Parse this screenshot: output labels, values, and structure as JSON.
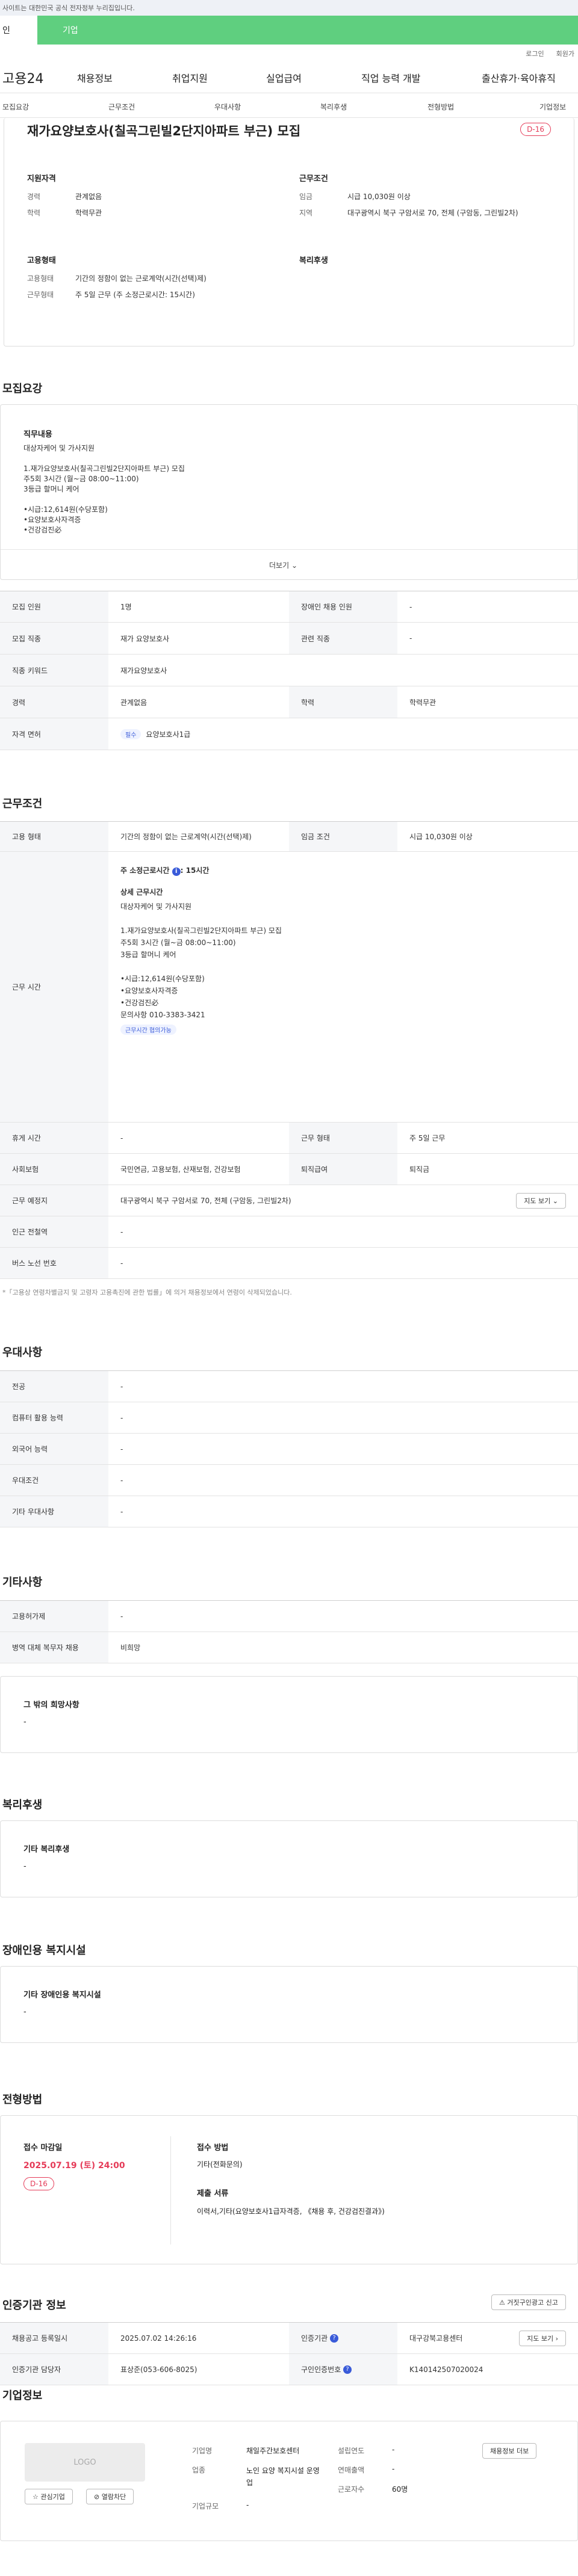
{
  "gov_banner": "사이트는 대한민국 공식 전자정부 누리집입니다.",
  "tabs": {
    "a": "인",
    "b": "기업"
  },
  "util": {
    "login": "로그인",
    "signup": "회원가"
  },
  "logo": "고용24",
  "gnb": [
    "채용정보",
    "취업지원",
    "실업급여",
    "직업 능력 개발",
    "출산휴가·육아휴직"
  ],
  "sub_tabs": [
    "모집요강",
    "근무조건",
    "우대사항",
    "복리후생",
    "전형방법",
    "기업정보"
  ],
  "job_title": "재가요양보호사(칠곡그린빌2단지아파트 부근) 모집",
  "dday": "D-16",
  "summary": {
    "qual_h": "지원자격",
    "career_k": "경력",
    "career_v": "관계없음",
    "edu_k": "학력",
    "edu_v": "학력무관",
    "work_h": "근무조건",
    "wage_k": "임금",
    "wage_v": "시급 10,030원 이상",
    "area_k": "지역",
    "area_v": "대구광역시 북구 구암서로 70, 전체 (구암동, 그린빌2차)",
    "emp_h": "고용형태",
    "emptype_k": "고용형태",
    "emptype_v": "기간의 정함이 없는 근로계약(시간(선택)제)",
    "worktype_k": "근무형태",
    "worktype_v": "주 5일 근무 (주 소정근로시간: 15시간)",
    "welfare_h": "복리후생"
  },
  "s_recruit": {
    "title": "모집요강",
    "duty_h": "직무내용",
    "duty_lines": [
      "대상자케어 및 가사지원",
      "",
      "1.재가요양보호사(칠곡그린빌2단지아파트 부근) 모집",
      "주5회 3시간 (월~금 08:00~11:00)",
      "3등급 할머니 케어",
      "",
      "•시급:12,614원(수당포함)",
      "•요양보호사자격증",
      "•건강검진必"
    ],
    "more": "더보기",
    "rows": [
      {
        "k1": "모집 인원",
        "v1": "1명",
        "k2": "장애인 채용 인원",
        "v2": "-"
      },
      {
        "k1": "모집 직종",
        "v1": "재가 요양보호사",
        "k2": "관련 직종",
        "v2": "-"
      },
      {
        "k1": "직종 키워드",
        "v1": "재가요양보호사"
      },
      {
        "k1": "경력",
        "v1": "관계없음",
        "k2": "학력",
        "v2": "학력무관"
      },
      {
        "k1": "자격 면허",
        "pill": "필수",
        "v1": "요양보호사1급"
      }
    ]
  },
  "s_work": {
    "title": "근무조건",
    "emp_k": "고용 형태",
    "emp_v": "기간의 정함이 없는 근로계약(시간(선택)제)",
    "wage_k": "임금 조건",
    "wage_v": "시급 10,030원 이상",
    "time_k": "근무 시간",
    "hours_label": "주 소정근로시간",
    "hours_v": "15시간",
    "detail_h": "상세 근무시간",
    "detail_lines": [
      "대상자케어 및 가사지원",
      "",
      "1.재가요양보호사(칠곡그린빌2단지아파트 부근) 모집",
      "주5회 3시간 (월~금 08:00~11:00)",
      "3등급 할머니 케어",
      "",
      "•시급:12,614원(수당포함)",
      "•요양보호사자격증",
      "•건강검진必",
      "문의사항 010-3383-3421"
    ],
    "flex_pill": "근무시간 협의가능",
    "rest_k": "휴게 시간",
    "rest_v": "-",
    "form_k": "근무 형태",
    "form_v": "주 5일 근무",
    "ins_k": "사회보험",
    "ins_v": "국민연금, 고용보험, 산재보험, 건강보험",
    "sev_k": "퇴직급여",
    "sev_v": "퇴직금",
    "loc_k": "근무 예정지",
    "loc_v": "대구광역시 북구 구암서로 70, 전체 (구암동, 그린빌2차)",
    "map_btn": "지도 보기",
    "sub_k": "인근 전철역",
    "sub_v": "-",
    "bus_k": "버스 노선 번호",
    "bus_v": "-",
    "note": "*「고용상 연령차별금지 및 고령자 고용촉진에 관한 법률」에 의거 채용정보에서 연령이 삭제되었습니다."
  },
  "s_pref": {
    "title": "우대사항",
    "rows": [
      {
        "k": "전공",
        "v": "-"
      },
      {
        "k": "컴퓨터 활용 능력",
        "v": "-"
      },
      {
        "k": "외국어 능력",
        "v": "-"
      },
      {
        "k": "우대조건",
        "v": "-"
      },
      {
        "k": "기타 우대사항",
        "v": "-"
      }
    ]
  },
  "s_other": {
    "title": "기타사항",
    "rows": [
      {
        "k": "고용허가제",
        "v": "-"
      },
      {
        "k": "병역 대체 복무자 채용",
        "v": "비희망"
      }
    ],
    "etc_h": "그 밖의 희망사항",
    "etc_v": "-"
  },
  "s_welfare": {
    "title": "복리후생",
    "h": "기타 복리후생",
    "v": "-"
  },
  "s_disabled": {
    "title": "장애인용 복지시설",
    "h": "기타 장애인용 복지시설",
    "v": "-"
  },
  "s_select": {
    "title": "전형방법",
    "deadline_h": "접수 마감일",
    "deadline_v": "2025.07.19 (토) 24:00",
    "dday": "D-16",
    "method_h": "접수 방법",
    "method_v": "기타(전화문의)",
    "docs_h": "제출 서류",
    "docs_v": "이력서,기타(요양보호사1급자격증, 《채용 후, 건강검진결과》)"
  },
  "s_auth": {
    "title": "인증기관 정보",
    "report_btn": "거짓구인광고 신고",
    "reg_k": "채용공고 등록일시",
    "reg_v": "2025.07.02 14:26:16",
    "org_k": "인증기관",
    "org_v": "대구강북고용센터",
    "map_btn": "지도 보기",
    "mgr_k": "인증기관 담당자",
    "mgr_v": "표상준(053-606-8025)",
    "no_k": "구인인증번호",
    "no_v": "K140142507020024"
  },
  "s_company": {
    "title": "기업정보",
    "logo": "LOGO",
    "fav_btn": "관심기업",
    "block_btn": "열람차단",
    "name_k": "기업명",
    "name_v": "채일주간보호센터",
    "ind_k": "업종",
    "ind_v": "노인 요양 복지시설 운영업",
    "size_k": "기업규모",
    "size_v": "-",
    "est_k": "설립연도",
    "est_v": "-",
    "sales_k": "연매출액",
    "sales_v": "-",
    "emp_k": "근로자수",
    "emp_v": "60명",
    "jobs_btn": "채용정보 더보"
  },
  "colors": {
    "accent": "#5fcf7f",
    "red": "#e53b58",
    "blue": "#3a5bd9"
  }
}
